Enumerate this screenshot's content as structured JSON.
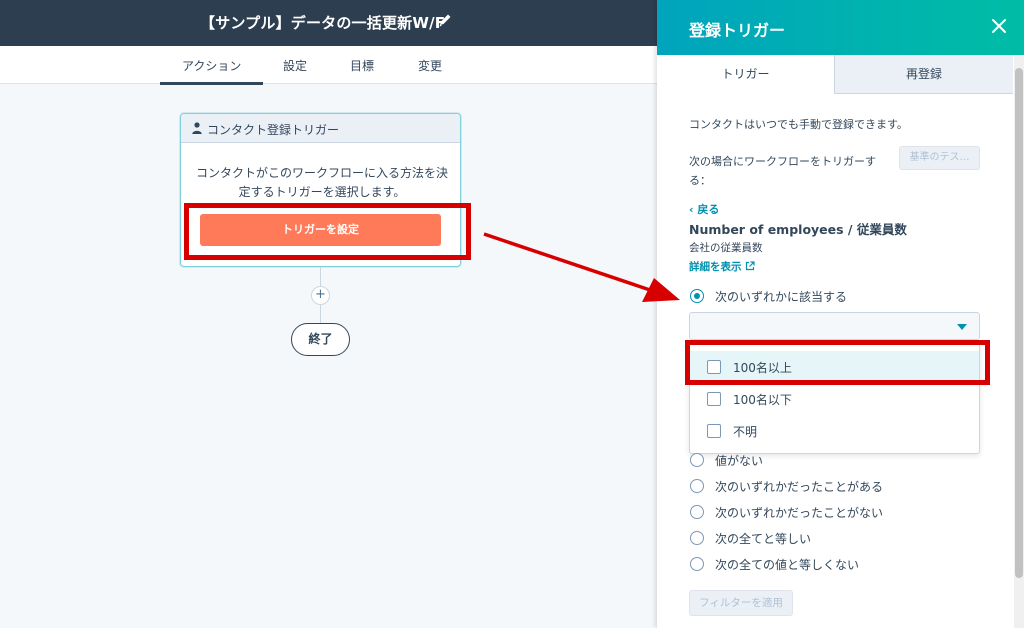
{
  "header": {
    "workflow_title": "【サンプル】データの一括更新W/F"
  },
  "tabs": [
    {
      "label": "アクション",
      "active": true
    },
    {
      "label": "設定"
    },
    {
      "label": "目標"
    },
    {
      "label": "変更"
    }
  ],
  "canvas": {
    "trigger_card": {
      "title": "コンタクト登録トリガー",
      "description": "コンタクトがこのワークフローに入る方法を決定するトリガーを選択します。",
      "button_label": "トリガーを設定"
    },
    "plus_label": "+",
    "end_label": "終了"
  },
  "panel": {
    "title": "登録トリガー",
    "tabs": [
      {
        "label": "トリガー",
        "active": true
      },
      {
        "label": "再登録"
      }
    ],
    "manual_note": "コンタクトはいつでも手動で登録できます。",
    "trigger_when_line1": "次の場合にワークフローをトリガーす",
    "trigger_when_line2": "る：",
    "test_button": "基準のテス…",
    "back_link": "‹ 戻る",
    "property_name": "Number of employees / 従業員数",
    "property_desc": "会社の従業員数",
    "detail_link": "詳細を表示",
    "selected_operator": "次のいずれかに該当する",
    "dropdown_value": "",
    "dropdown_options": [
      {
        "label": "100名以上",
        "checked": false
      },
      {
        "label": "100名以下",
        "checked": false
      },
      {
        "label": "不明",
        "checked": false
      }
    ],
    "other_operators": [
      "値がない",
      "次のいずれかだったことがある",
      "次のいずれかだったことがない",
      "次の全てと等しい",
      "次の全ての値と等しくない"
    ],
    "apply_button": "フィルターを適用"
  },
  "colors": {
    "topbar": "#2d3e50",
    "accent_orange": "#ff7a59",
    "panel_gradient_start": "#00a4bd",
    "panel_gradient_end": "#00bda5",
    "highlight_red": "#d60000",
    "link_teal": "#0091ae"
  }
}
